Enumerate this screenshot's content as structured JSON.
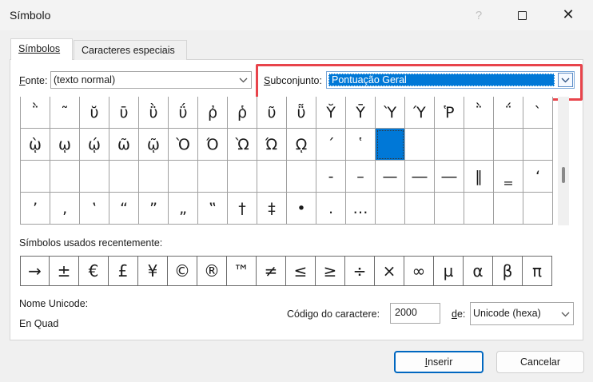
{
  "window": {
    "title": "Símbolo",
    "help": "?",
    "close": "✕"
  },
  "tabs": [
    {
      "label": "Símbolos",
      "active": true
    },
    {
      "label": "Caracteres especiais",
      "active": false
    }
  ],
  "font": {
    "label_accel": "F",
    "label_rest": "onte:",
    "value": "(texto normal)"
  },
  "subset": {
    "label_accel": "S",
    "label_rest": "ubconjunto:",
    "value": "Pontuação Geral"
  },
  "symbol_grid": {
    "rows": [
      [
        "῭",
        "῀",
        "ῠ",
        "ῡ",
        "ῢ",
        "ΰ",
        "ῤ",
        "ῥ",
        "ῦ",
        "ῧ",
        "Ῠ",
        "Ῡ",
        "Ὺ",
        "Ύ",
        "Ῥ",
        "῭",
        "΅",
        "`"
      ],
      [
        "ῲ",
        "ῳ",
        "ῴ",
        "ῶ",
        "ῷ",
        "Ὸ",
        "Ό",
        "Ὼ",
        "Ώ",
        "ῼ",
        "´",
        "῾",
        "",
        "",
        "",
        "",
        "",
        ""
      ],
      [
        "",
        "",
        "",
        "",
        "",
        "",
        "",
        "",
        "",
        "",
        "‐",
        "–",
        "—",
        "―",
        "―",
        "‖",
        "‗",
        "‘"
      ],
      [
        "’",
        "‚",
        "‛",
        "“",
        "”",
        "„",
        "‟",
        "†",
        "‡",
        "•",
        "․",
        "…",
        "",
        "",
        "",
        "",
        "",
        ""
      ]
    ],
    "selected_row": 1,
    "selected_col": 12
  },
  "recent": {
    "label": "Símbolos usados recentemente:",
    "symbols": [
      "→",
      "±",
      "€",
      "£",
      "¥",
      "©",
      "®",
      "™",
      "≠",
      "≤",
      "≥",
      "÷",
      "×",
      "∞",
      "µ",
      "α",
      "β",
      "π"
    ]
  },
  "unicode_name": {
    "label": "Nome Unicode:",
    "value": "En Quad"
  },
  "char_code": {
    "label": "Código do caractere:",
    "value": "2000"
  },
  "from": {
    "label_accel": "d",
    "label_rest": "e:",
    "value": "Unicode (hexa)"
  },
  "buttons": {
    "insert_accel": "I",
    "insert_rest": "nserir",
    "cancel": "Cancelar"
  },
  "colors": {
    "selection": "#0078d7",
    "highlight": "#e8444b",
    "default_button_border": "#0067c0"
  }
}
